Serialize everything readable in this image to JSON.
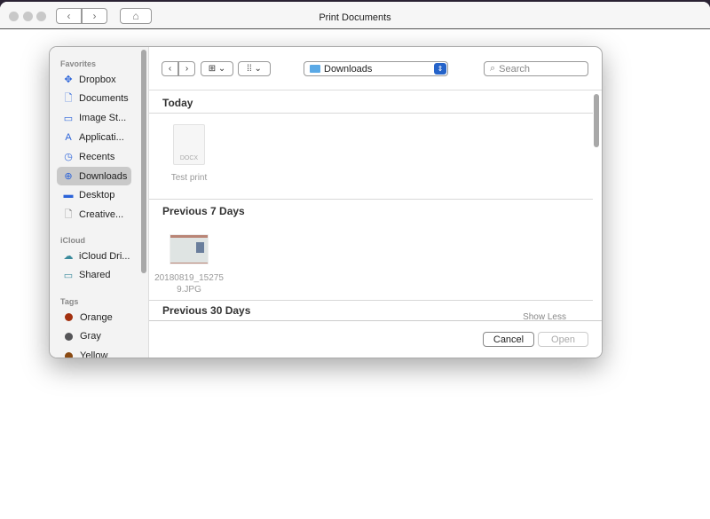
{
  "window": {
    "title": "Print Documents"
  },
  "sidebar": {
    "favorites_label": "Favorites",
    "favorites": [
      {
        "label": "Dropbox",
        "icon": "dropbox-icon",
        "glyph": "✥"
      },
      {
        "label": "Documents",
        "icon": "document-icon",
        "glyph": "🗋"
      },
      {
        "label": "Image St...",
        "icon": "folder-icon",
        "glyph": "▭"
      },
      {
        "label": "Applicati...",
        "icon": "applications-icon",
        "glyph": "A"
      },
      {
        "label": "Recents",
        "icon": "clock-icon",
        "glyph": "◷"
      },
      {
        "label": "Downloads",
        "icon": "download-icon",
        "glyph": "⊕",
        "selected": true
      },
      {
        "label": "Desktop",
        "icon": "desktop-icon",
        "glyph": "▬"
      },
      {
        "label": "Creative...",
        "icon": "file-icon",
        "glyph": "🗋"
      }
    ],
    "icloud_label": "iCloud",
    "icloud": [
      {
        "label": "iCloud Dri...",
        "icon": "cloud-icon",
        "glyph": "☁"
      },
      {
        "label": "Shared",
        "icon": "shared-folder-icon",
        "glyph": "▭"
      }
    ],
    "tags_label": "Tags",
    "tags": [
      {
        "label": "Orange",
        "color": "#a3300f"
      },
      {
        "label": "Gray",
        "color": "#555558"
      },
      {
        "label": "Yellow",
        "color": "#8a4a12"
      }
    ]
  },
  "toolbar": {
    "location": "Downloads",
    "search_placeholder": "Search"
  },
  "groups": [
    {
      "title": "Today",
      "files": [
        {
          "name": "Test print",
          "type_label": "DOCX"
        }
      ]
    },
    {
      "title": "Previous 7 Days",
      "files": [
        {
          "name": "20180819_15275\n9.JPG"
        }
      ]
    },
    {
      "title": "Previous 30 Days",
      "action": "Show Less"
    }
  ],
  "buttons": {
    "cancel": "Cancel",
    "open": "Open"
  }
}
